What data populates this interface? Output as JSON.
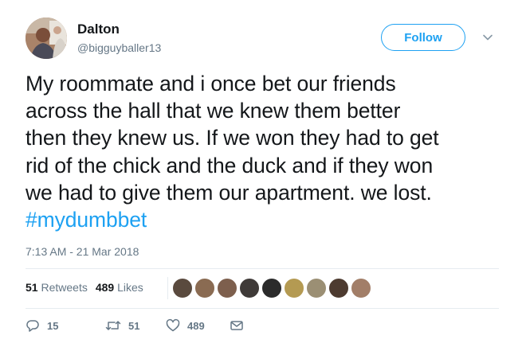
{
  "user": {
    "name": "Dalton",
    "handle": "@bigguyballer13",
    "follow_label": "Follow"
  },
  "tweet": {
    "lines": [
      "My roommate and i once bet our friends",
      "across the hall that we knew them better",
      "then they knew us. If we won they had to get",
      "rid of the chick and the duck and if they won",
      "we had to give them our apartment. we lost."
    ],
    "hashtag": "#mydumbbet",
    "timestamp": "7:13 AM - 21 Mar 2018"
  },
  "stats": {
    "retweets_count": "51",
    "retweets_label": "Retweets",
    "likes_count": "489",
    "likes_label": "Likes"
  },
  "actions": {
    "reply_count": "15",
    "retweet_count": "51",
    "like_count": "489"
  },
  "colors": {
    "accent": "#1da1f2",
    "secondary_text": "#657786",
    "divider": "#e6ecf0"
  }
}
